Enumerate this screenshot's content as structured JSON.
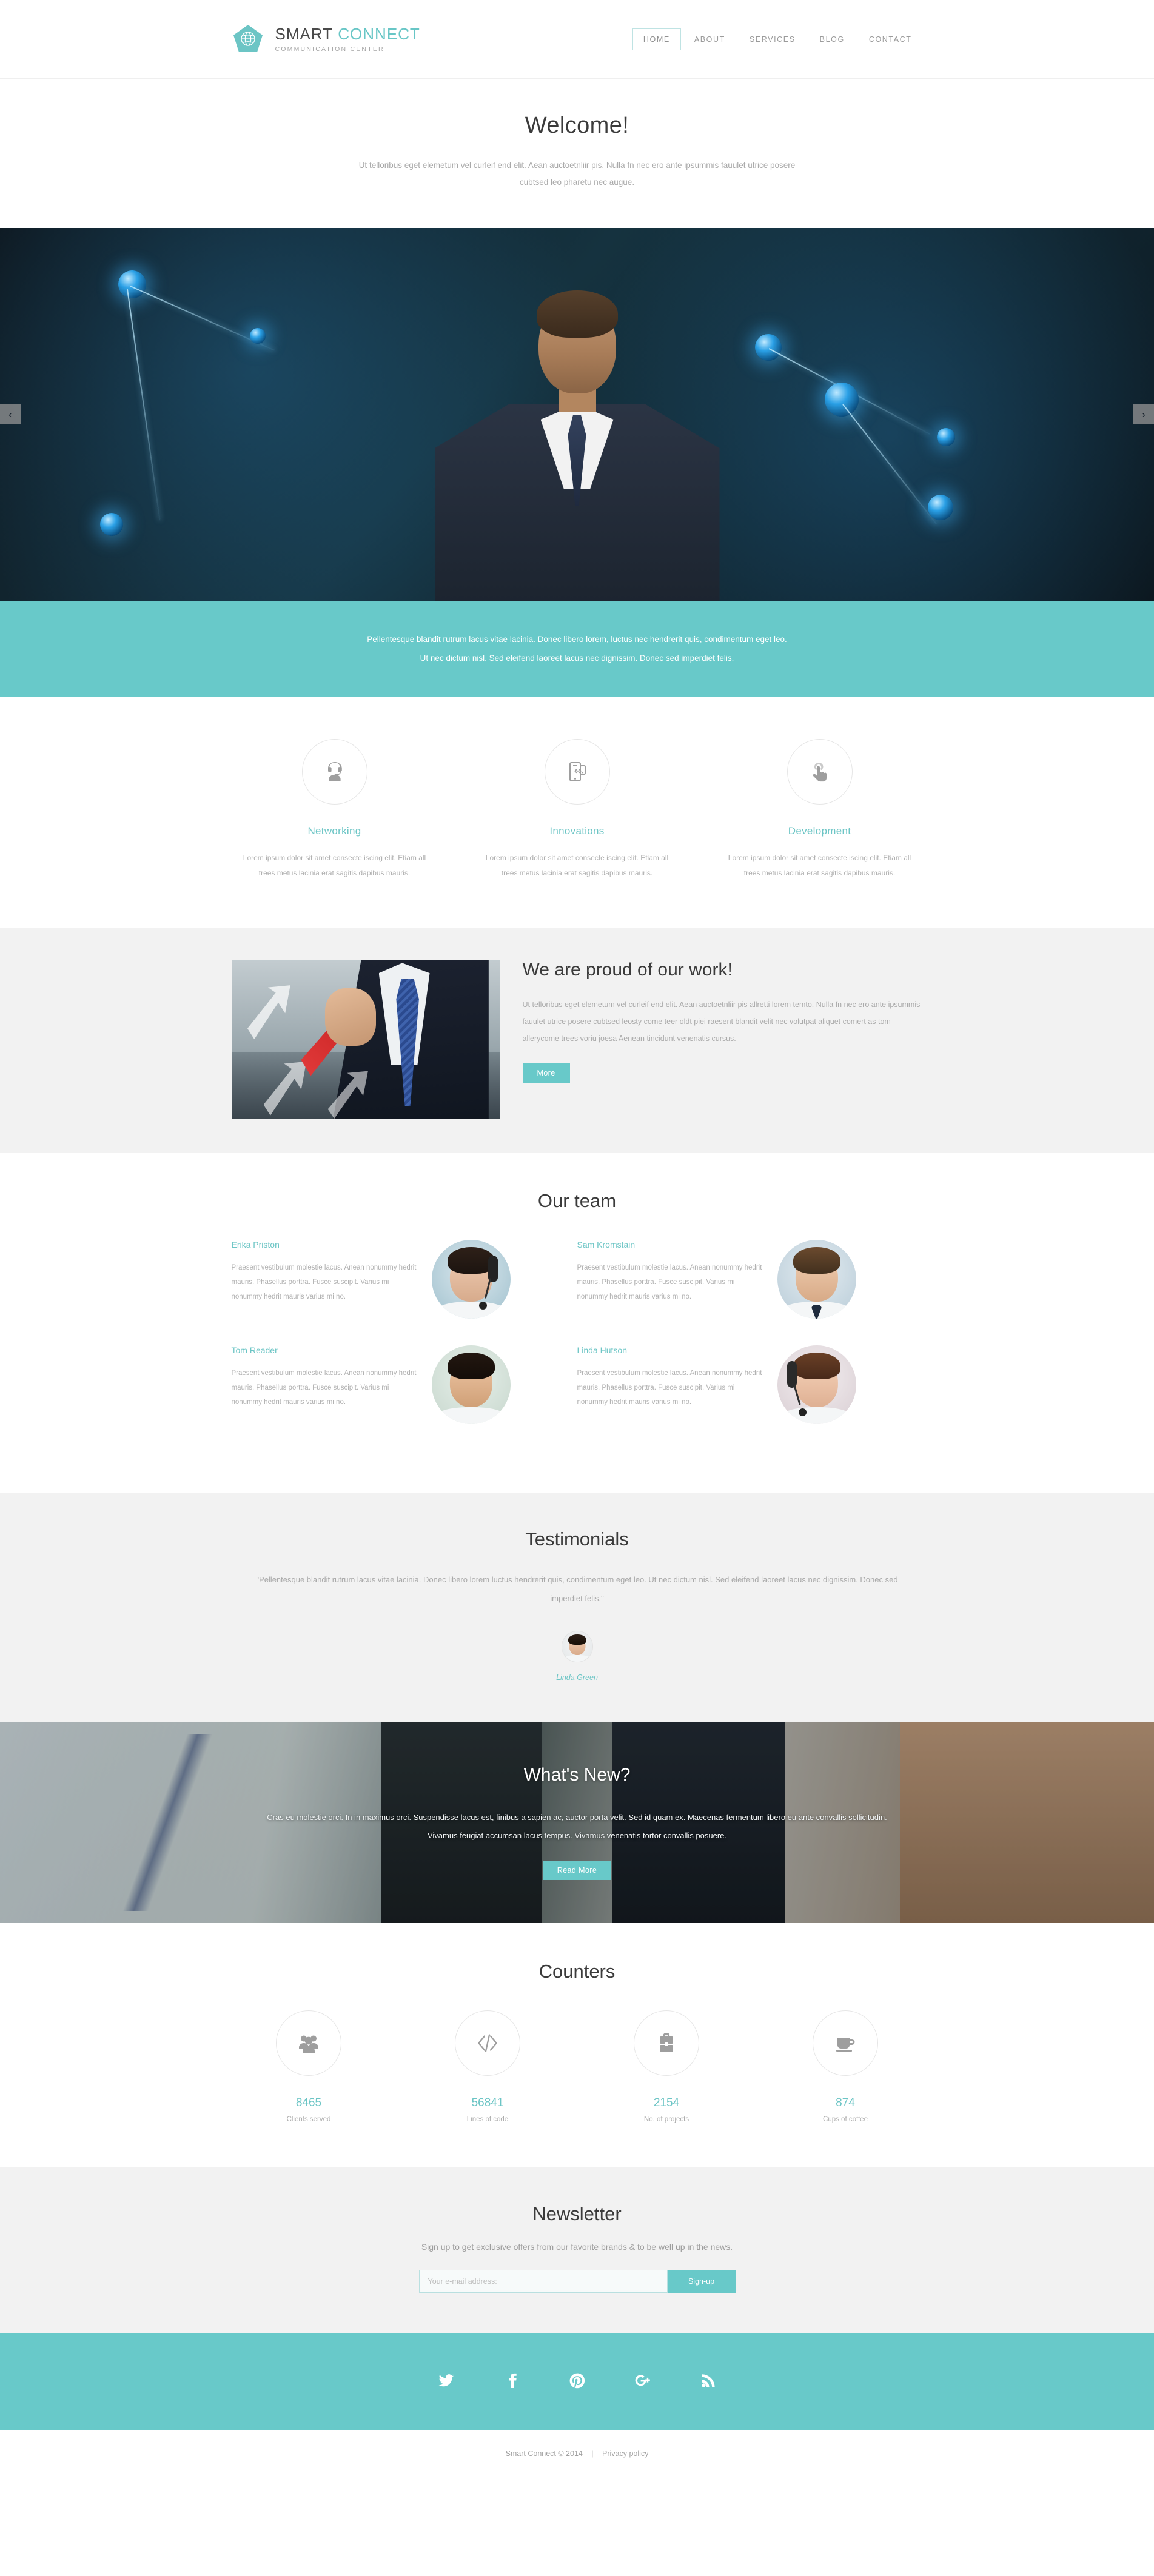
{
  "brand": {
    "name_part1": "SMART",
    "name_part2": "CONNECT",
    "tagline": "COMMUNICATION CENTER"
  },
  "nav": {
    "items": [
      {
        "label": "HOME",
        "active": true
      },
      {
        "label": "ABOUT",
        "active": false
      },
      {
        "label": "SERVICES",
        "active": false
      },
      {
        "label": "BLOG",
        "active": false
      },
      {
        "label": "CONTACT",
        "active": false
      }
    ]
  },
  "welcome": {
    "title": "Welcome!",
    "text": "Ut telloribus eget elemetum vel curleif end elit. Aean auctoetnliir pis. Nulla fn nec ero ante ipsummis fauulet utrice posere cubtsed leo pharetu nec augue."
  },
  "slider": {
    "prev_icon": "‹",
    "next_icon": "›"
  },
  "teal_bar": {
    "line1": "Pellentesque blandit rutrum lacus vitae lacinia. Donec libero lorem, luctus nec hendrerit quis, condimentum eget leo.",
    "line2": "Ut nec dictum nisl. Sed eleifend laoreet lacus nec dignissim. Donec sed imperdiet felis."
  },
  "services": [
    {
      "icon": "headset-operator-icon",
      "title": "Networking",
      "text": "Lorem ipsum dolor sit amet consecte iscing elit. Etiam all trees metus lacinia erat sagitis dapibus mauris."
    },
    {
      "icon": "mobile-devices-icon",
      "title": "Innovations",
      "text": "Lorem ipsum dolor sit amet consecte iscing elit. Etiam all trees metus lacinia erat sagitis dapibus mauris."
    },
    {
      "icon": "touch-hand-icon",
      "title": "Development",
      "text": "Lorem ipsum dolor sit amet consecte iscing elit. Etiam all trees metus lacinia erat sagitis dapibus mauris."
    }
  ],
  "proud": {
    "title": "We are proud of our work!",
    "paragraph": "Ut telloribus eget elemetum vel curleif end elit. Aean auctoetnliir pis allretti lorem temto. Nulla fn nec ero ante ipsummis fauulet utrice posere cubtsed leosty come teer oldt piei raesent blandit velit nec volutpat aliquet comert as tom allerycome trees voriu joesa Aenean tincidunt venenatis cursus.",
    "button": "More"
  },
  "team": {
    "title": "Our team",
    "members": [
      {
        "name": "Erika Priston",
        "bio": "Praesent vestibulum molestie lacus. Anean nonummy hedrit mauris. Phasellus porttra. Fusce suscipit. Varius mi nonummy hedrit mauris varius mi no.",
        "photo": "female-operator-headset"
      },
      {
        "name": "Sam Kromstain",
        "bio": "Praesent vestibulum molestie lacus. Anean nonummy hedrit mauris. Phasellus porttra. Fusce suscipit. Varius mi nonummy hedrit mauris varius mi no.",
        "photo": "male-suit-portrait"
      },
      {
        "name": "Tom Reader",
        "bio": "Praesent vestibulum molestie lacus. Anean nonummy hedrit mauris. Phasellus porttra. Fusce suscipit. Varius mi nonummy hedrit mauris varius mi no.",
        "photo": "male-shirt-portrait"
      },
      {
        "name": "Linda Hutson",
        "bio": "Praesent vestibulum molestie lacus. Anean nonummy hedrit mauris. Phasellus porttra. Fusce suscipit. Varius mi nonummy hedrit mauris varius mi no.",
        "photo": "female-operator-smiling"
      }
    ]
  },
  "testimonials": {
    "title": "Testimonials",
    "quote": "\"Pellentesque blandit rutrum lacus vitae lacinia. Donec libero lorem luctus hendrerit quis, condimentum eget leo. Ut nec dictum nisl. Sed eleifend laoreet lacus nec dignissim. Donec sed imperdiet felis.\"",
    "author": "Linda Green"
  },
  "whats_new": {
    "title": "What's New?",
    "text": "Cras eu molestie orci. In in maximus orci. Suspendisse lacus est, finibus a sapien ac, auctor porta velit. Sed id quam ex. Maecenas fermentum libero eu ante convallis sollicitudin. Vivamus feugiat accumsan lacus tempus. Vivamus venenatis tortor convallis posuere.",
    "button": "Read More"
  },
  "counters": {
    "title": "Counters",
    "items": [
      {
        "icon": "users-group-icon",
        "value": "8465",
        "label": "Clients served"
      },
      {
        "icon": "code-brackets-icon",
        "value": "56841",
        "label": "Lines of code"
      },
      {
        "icon": "briefcase-icon",
        "value": "2154",
        "label": "No. of projects"
      },
      {
        "icon": "coffee-cup-icon",
        "value": "874",
        "label": "Cups of coffee"
      }
    ]
  },
  "newsletter": {
    "title": "Newsletter",
    "subtitle": "Sign up to get exclusive offers from our favorite brands & to be well up in the news.",
    "placeholder": "Your e-mail address:",
    "value": "",
    "button": "Sign-up"
  },
  "footer": {
    "social": [
      {
        "icon": "twitter-icon",
        "name": "Twitter"
      },
      {
        "icon": "facebook-icon",
        "name": "Facebook"
      },
      {
        "icon": "pinterest-icon",
        "name": "Pinterest"
      },
      {
        "icon": "google-plus-icon",
        "name": "Google Plus"
      },
      {
        "icon": "rss-icon",
        "name": "RSS"
      }
    ],
    "copyright": "Smart Connect © 2014",
    "privacy": "Privacy policy",
    "separator": "|"
  },
  "colors": {
    "accent": "#68c9c9",
    "accent_text": "#6cc5c5",
    "heading": "#3b3b3b",
    "body_text": "#a9a9a9",
    "light_bg": "#f2f2f2"
  }
}
